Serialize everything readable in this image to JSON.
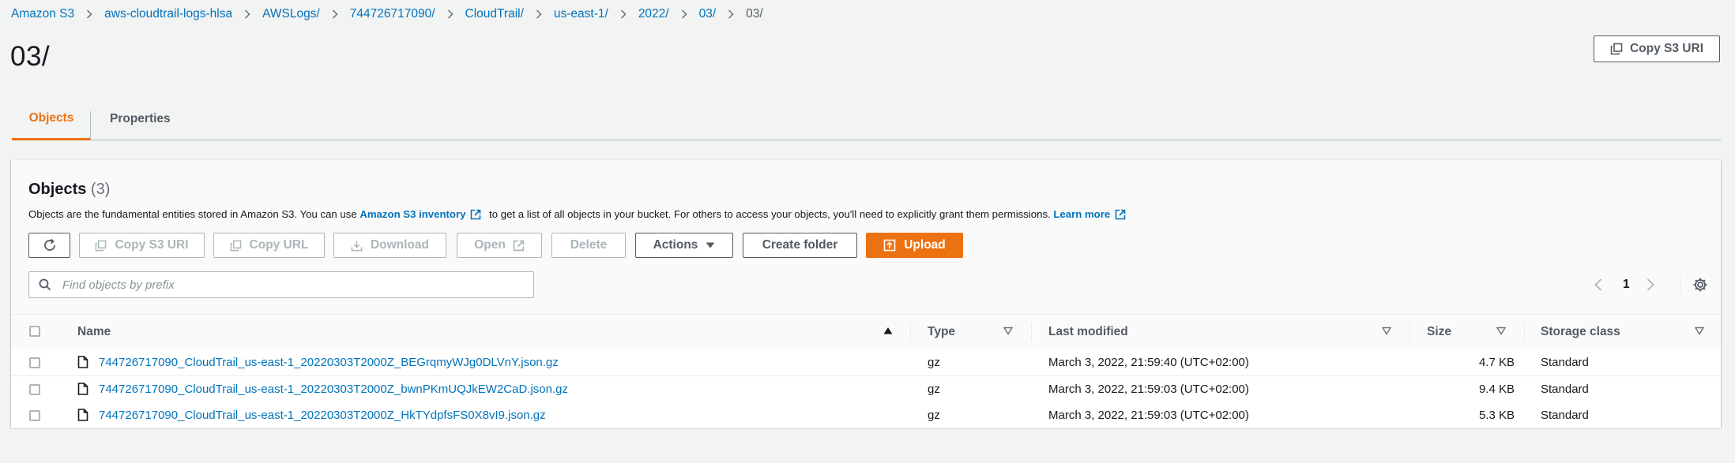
{
  "breadcrumb": {
    "items": [
      "Amazon S3",
      "aws-cloudtrail-logs-hlsa",
      "AWSLogs/",
      "744726717090/",
      "CloudTrail/",
      "us-east-1/",
      "2022/",
      "03/",
      "03/"
    ]
  },
  "page": {
    "title": "03/",
    "copy_s3_uri_label": "Copy S3 URI"
  },
  "tabs": [
    {
      "label": "Objects",
      "active": true
    },
    {
      "label": "Properties",
      "active": false
    }
  ],
  "objects_panel": {
    "title": "Objects",
    "count": "(3)",
    "desc_before": "Objects are the fundamental entities stored in Amazon S3. You can use ",
    "inventory_link": "Amazon S3 inventory",
    "desc_middle": " to get a list of all objects in your bucket. For others to access your objects, you'll need to explicitly grant them permissions. ",
    "learn_more": "Learn more"
  },
  "toolbar": {
    "refresh_icon": "refresh-icon",
    "copy_s3_uri": "Copy S3 URI",
    "copy_url": "Copy URL",
    "download": "Download",
    "open": "Open",
    "delete": "Delete",
    "actions": "Actions",
    "create_folder": "Create folder",
    "upload": "Upload"
  },
  "search": {
    "placeholder": "Find objects by prefix",
    "value": ""
  },
  "pagination": {
    "current_page": "1"
  },
  "table": {
    "columns": {
      "name": "Name",
      "type": "Type",
      "last_modified": "Last modified",
      "size": "Size",
      "storage_class": "Storage class"
    },
    "rows": [
      {
        "name": "744726717090_CloudTrail_us-east-1_20220303T2000Z_BEGrqmyWJg0DLVnY.json.gz",
        "type": "gz",
        "last_modified": "March 3, 2022, 21:59:40 (UTC+02:00)",
        "size": "4.7 KB",
        "storage_class": "Standard"
      },
      {
        "name": "744726717090_CloudTrail_us-east-1_20220303T2000Z_bwnPKmUQJkEW2CaD.json.gz",
        "type": "gz",
        "last_modified": "March 3, 2022, 21:59:03 (UTC+02:00)",
        "size": "9.4 KB",
        "storage_class": "Standard"
      },
      {
        "name": "744726717090_CloudTrail_us-east-1_20220303T2000Z_HkTYdpfsFS0X8vI9.json.gz",
        "type": "gz",
        "last_modified": "March 3, 2022, 21:59:03 (UTC+02:00)",
        "size": "5.3 KB",
        "storage_class": "Standard"
      }
    ]
  },
  "colors": {
    "accent": "#ec7211",
    "link": "#0073bb",
    "text": "#16191f",
    "muted": "#545b64",
    "disabled": "#aab7b8",
    "background": "#f2f3f3"
  }
}
